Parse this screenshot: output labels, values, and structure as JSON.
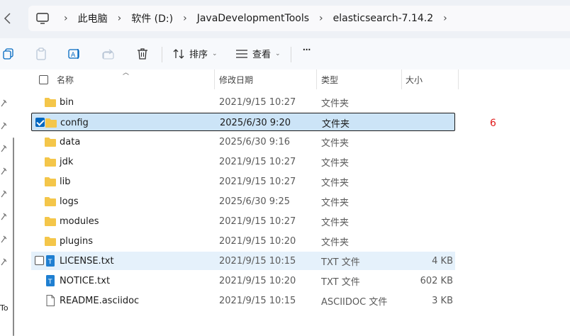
{
  "breadcrumb": {
    "items": [
      "此电脑",
      "软件 (D:)",
      "JavaDevelopmentTools",
      "elasticsearch-7.14.2"
    ],
    "separator": "›"
  },
  "toolbar": {
    "sort_label": "排序",
    "view_label": "查看",
    "more_label": "···"
  },
  "navpane": {
    "partial_text": "To"
  },
  "columns": {
    "name": "名称",
    "date": "修改日期",
    "type": "类型",
    "size": "大小"
  },
  "files": [
    {
      "name": "bin",
      "date": "2021/9/15 10:27",
      "type": "文件夹",
      "size": "",
      "kind": "folder"
    },
    {
      "name": "config",
      "date": "2025/6/30 9:20",
      "type": "文件夹",
      "size": "",
      "kind": "folder",
      "state": "selected"
    },
    {
      "name": "data",
      "date": "2025/6/30 9:16",
      "type": "文件夹",
      "size": "",
      "kind": "folder"
    },
    {
      "name": "jdk",
      "date": "2021/9/15 10:27",
      "type": "文件夹",
      "size": "",
      "kind": "folder"
    },
    {
      "name": "lib",
      "date": "2021/9/15 10:27",
      "type": "文件夹",
      "size": "",
      "kind": "folder"
    },
    {
      "name": "logs",
      "date": "2025/6/30 9:25",
      "type": "文件夹",
      "size": "",
      "kind": "folder"
    },
    {
      "name": "modules",
      "date": "2021/9/15 10:27",
      "type": "文件夹",
      "size": "",
      "kind": "folder"
    },
    {
      "name": "plugins",
      "date": "2021/9/15 10:20",
      "type": "文件夹",
      "size": "",
      "kind": "folder"
    },
    {
      "name": "LICENSE.txt",
      "date": "2021/9/15 10:15",
      "type": "TXT 文件",
      "size": "4 KB",
      "kind": "txt",
      "state": "hover"
    },
    {
      "name": "NOTICE.txt",
      "date": "2021/9/15 10:20",
      "type": "TXT 文件",
      "size": "602 KB",
      "kind": "txt"
    },
    {
      "name": "README.asciidoc",
      "date": "2021/9/15 10:15",
      "type": "ASCIIDOC 文件",
      "size": "3 KB",
      "kind": "doc"
    }
  ],
  "annotation": "6",
  "colors": {
    "accent": "#0067c0",
    "selected_bg": "#cce4f7",
    "hover_bg": "#e5f1fb",
    "folder": "#f4c64a",
    "annotation": "#e01a1a"
  }
}
